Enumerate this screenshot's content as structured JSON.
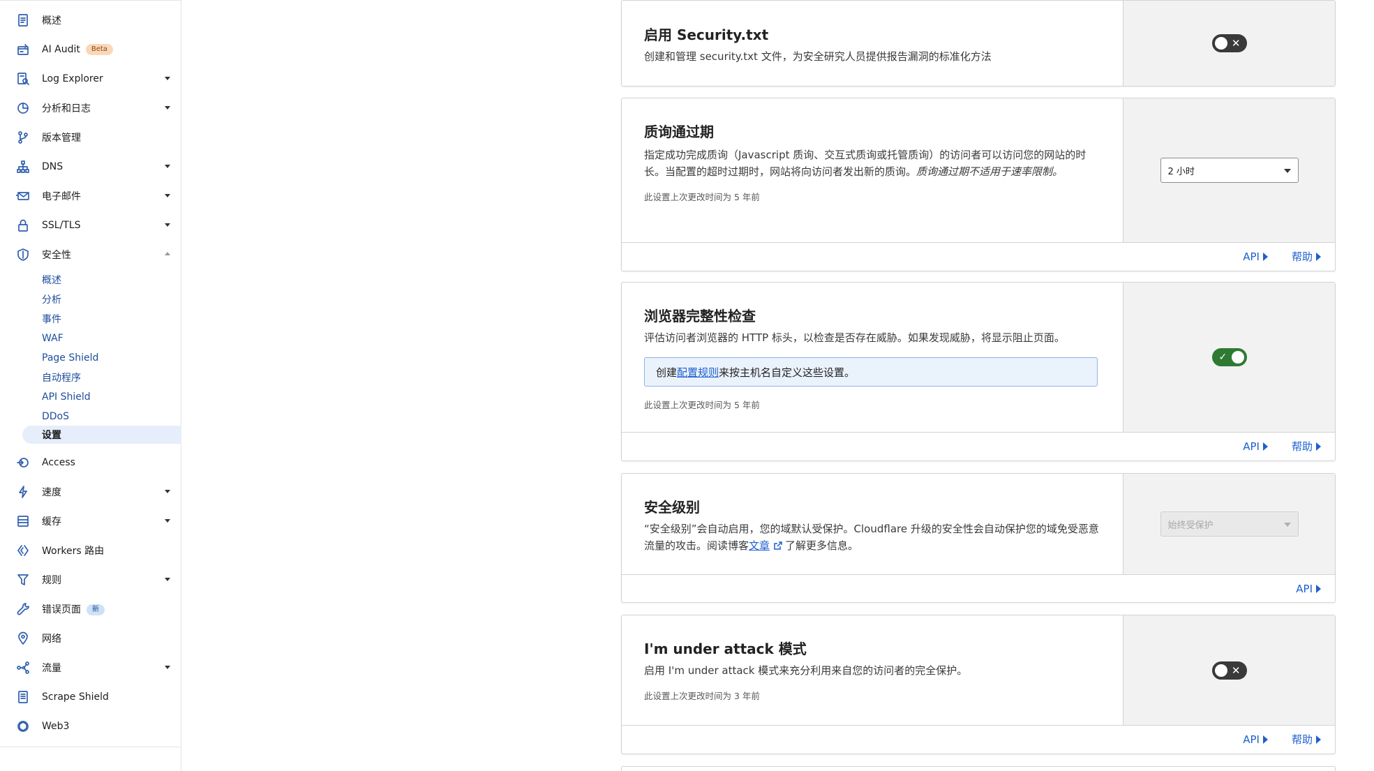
{
  "sidebar": {
    "items": [
      {
        "label": "概述",
        "icon": "document-icon",
        "expandable": false
      },
      {
        "label": "AI Audit",
        "icon": "ai-audit-icon",
        "badge": "Beta",
        "expandable": false
      },
      {
        "label": "Log Explorer",
        "icon": "log-explorer-icon",
        "expandable": true
      },
      {
        "label": "分析和日志",
        "icon": "analytics-icon",
        "expandable": true
      },
      {
        "label": "版本管理",
        "icon": "branch-icon",
        "expandable": false
      },
      {
        "label": "DNS",
        "icon": "dns-icon",
        "expandable": true
      },
      {
        "label": "电子邮件",
        "icon": "email-icon",
        "expandable": true
      },
      {
        "label": "SSL/TLS",
        "icon": "lock-icon",
        "expandable": true
      },
      {
        "label": "安全性",
        "icon": "shield-icon",
        "expandable": true,
        "expanded": true
      },
      {
        "label": "Access",
        "icon": "access-icon",
        "expandable": false
      },
      {
        "label": "速度",
        "icon": "lightning-icon",
        "expandable": true
      },
      {
        "label": "缓存",
        "icon": "cache-icon",
        "expandable": true
      },
      {
        "label": "Workers 路由",
        "icon": "workers-icon",
        "expandable": false
      },
      {
        "label": "规则",
        "icon": "rules-icon",
        "expandable": true
      },
      {
        "label": "错误页面",
        "icon": "wrench-icon",
        "badge": "新",
        "expandable": false
      },
      {
        "label": "网络",
        "icon": "location-pin-icon",
        "expandable": false
      },
      {
        "label": "流量",
        "icon": "traffic-icon",
        "expandable": true
      },
      {
        "label": "Scrape Shield",
        "icon": "scrape-shield-icon",
        "expandable": false
      },
      {
        "label": "Web3",
        "icon": "web3-icon",
        "expandable": false
      }
    ],
    "security_sub": [
      "概述",
      "分析",
      "事件",
      "WAF",
      "Page Shield",
      "自动程序",
      "API Shield",
      "DDoS",
      "设置"
    ],
    "active_sub": "设置"
  },
  "cards": {
    "securitytxt": {
      "title": "启用 Security.txt",
      "desc": "创建和管理 security.txt 文件，为安全研究人员提供报告漏洞的标准化方法",
      "toggle_on": false,
      "toggle_mark_off": "✕"
    },
    "challenge": {
      "title": "质询通过期",
      "desc_main": "指定成功完成质询（Javascript 质询、交互式质询或托管质询）的访问者可以访问您的网站的时长。当配置的超时过期时，网站将向访问者发出新的质询。",
      "desc_italic": "质询通过期不适用于速率限制。",
      "meta": "此设置上次更改时间为 5 年前",
      "select_value": "2 小时",
      "api": "API",
      "help": "帮助"
    },
    "browser": {
      "title": "浏览器完整性检查",
      "desc": "评估访问者浏览器的 HTTP 标头，以检查是否存在威胁。如果发现威胁，将显示阻止页面。",
      "info_prefix": "创建",
      "info_link": "配置规则",
      "info_suffix": "来按主机名自定义这些设置。",
      "meta": "此设置上次更改时间为 5 年前",
      "toggle_on": true,
      "toggle_mark_on": "✓",
      "api": "API",
      "help": "帮助"
    },
    "seclevel": {
      "title": "安全级别",
      "desc_main": "“安全级别”会自动启用，您的域默认受保护。Cloudflare 升级的安全性会自动保护您的域免受恶意流量的攻击。阅读博客",
      "desc_link": "文章",
      "desc_suffix": "了解更多信息。",
      "select_value": "始终受保护",
      "select_disabled": true,
      "api": "API"
    },
    "attack": {
      "title": "I'm under attack 模式",
      "desc": "启用 I'm under attack 模式来充分利用来自您的访问者的完全保护。",
      "meta": "此设置上次更改时间为 3 年前",
      "toggle_on": false,
      "toggle_mark_off": "✕",
      "api": "API",
      "help": "帮助"
    }
  },
  "colors": {
    "accent_blue": "#1d5fce",
    "icon_blue": "#2f5fae",
    "toggle_on": "#2e7a33",
    "toggle_off": "#3a3a3a",
    "beta_badge": "#fbd7b9",
    "new_badge": "#cfe1f7"
  }
}
